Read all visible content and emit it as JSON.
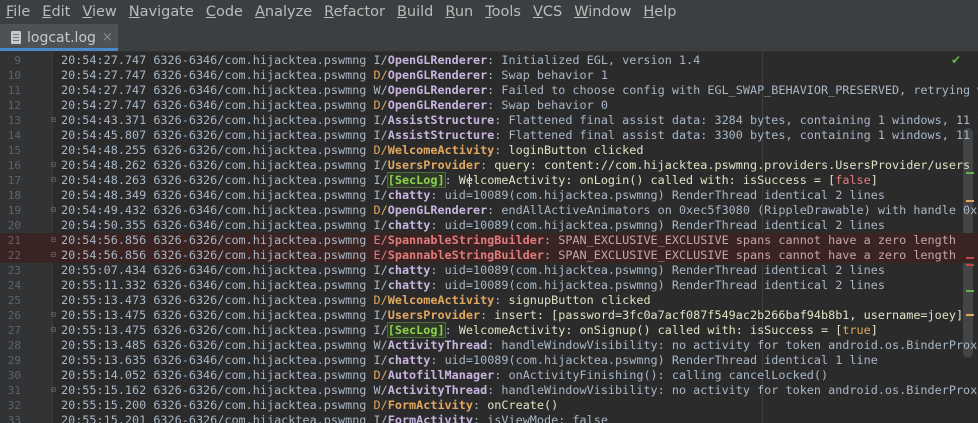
{
  "menu": [
    "File",
    "Edit",
    "View",
    "Navigate",
    "Code",
    "Analyze",
    "Refactor",
    "Build",
    "Run",
    "Tools",
    "VCS",
    "Window",
    "Help"
  ],
  "tab": {
    "label": "logcat.log",
    "close": "×"
  },
  "colors": {
    "accent": "#4a88c7",
    "error_row": "#3a2323",
    "seclog": "#8ed24e"
  },
  "lines": [
    {
      "n": "9",
      "ts": "20:54:27.747",
      "pid": "6326-6346",
      "pkg": "com.hijacktea.pswmng",
      "lvl": "I",
      "tag": "OpenGLRenderer",
      "msg": "Initialized EGL, version 1.4"
    },
    {
      "n": "10",
      "ts": "20:54:27.747",
      "pid": "6326-6346",
      "pkg": "com.hijacktea.pswmng",
      "lvl": "D",
      "tag": "OpenGLRenderer",
      "msg": "Swap behavior 1"
    },
    {
      "n": "11",
      "ts": "20:54:27.747",
      "pid": "6326-6346",
      "pkg": "com.hijacktea.pswmng",
      "lvl": "W",
      "tag": "OpenGLRenderer",
      "msg": "Failed to choose config with EGL_SWAP_BEHAVIOR_PRESERVED, retrying wi"
    },
    {
      "n": "12",
      "ts": "20:54:27.747",
      "pid": "6326-6346",
      "pkg": "com.hijacktea.pswmng",
      "lvl": "D",
      "tag": "OpenGLRenderer",
      "msg": "Swap behavior 0"
    },
    {
      "n": "13",
      "ts": "20:54:43.371",
      "pid": "6326-6326",
      "pkg": "com.hijacktea.pswmng",
      "lvl": "I",
      "tag": "AssistStructure",
      "msg": "Flattened final assist data: 3284 bytes, containing 1 windows, 11 vi"
    },
    {
      "n": "14",
      "ts": "20:54:45.807",
      "pid": "6326-6326",
      "pkg": "com.hijacktea.pswmng",
      "lvl": "I",
      "tag": "AssistStructure",
      "msg": "Flattened final assist data: 3300 bytes, containing 1 windows, 11 vi"
    },
    {
      "n": "15",
      "ts": "20:54:48.255",
      "pid": "6326-6326",
      "pkg": "com.hijacktea.pswmng",
      "lvl": "D",
      "tag": "WelcomeActivity",
      "msg": "loginButton clicked"
    },
    {
      "n": "16",
      "ts": "20:54:48.262",
      "pid": "6326-6326",
      "pkg": "com.hijacktea.pswmng",
      "lvl": "I",
      "tag": "UsersProvider",
      "msg": "query: content://com.hijacktea.pswmng.providers.UsersProvider/users"
    },
    {
      "n": "17",
      "ts": "20:54:48.263",
      "pid": "6326-6326",
      "pkg": "com.hijacktea.pswmng",
      "lvl": "I",
      "tag": "[SecLog]",
      "msg": "WelcomeActivity: onLogin() called with: isSuccess = [false]"
    },
    {
      "n": "18",
      "ts": "20:54:48.349",
      "pid": "6326-6346",
      "pkg": "com.hijacktea.pswmng",
      "lvl": "I",
      "tag": "chatty",
      "msg": "uid=10089(com.hijacktea.pswmng) RenderThread identical 2 lines"
    },
    {
      "n": "19",
      "ts": "20:54:49.432",
      "pid": "6326-6346",
      "pkg": "com.hijacktea.pswmng",
      "lvl": "D",
      "tag": "OpenGLRenderer",
      "msg": "endAllActiveAnimators on 0xec5f3080 (RippleDrawable) with handle 0xe"
    },
    {
      "n": "20",
      "ts": "20:54:50.355",
      "pid": "6326-6346",
      "pkg": "com.hijacktea.pswmng",
      "lvl": "I",
      "tag": "chatty",
      "msg": "uid=10089(com.hijacktea.pswmng) RenderThread identical 2 lines"
    },
    {
      "n": "21",
      "ts": "20:54:56.856",
      "pid": "6326-6326",
      "pkg": "com.hijacktea.pswmng",
      "lvl": "E",
      "tag": "SpannableStringBuilder",
      "msg": "SPAN_EXCLUSIVE_EXCLUSIVE spans cannot have a zero length"
    },
    {
      "n": "22",
      "ts": "20:54:56.856",
      "pid": "6326-6326",
      "pkg": "com.hijacktea.pswmng",
      "lvl": "E",
      "tag": "SpannableStringBuilder",
      "msg": "SPAN_EXCLUSIVE_EXCLUSIVE spans cannot have a zero length"
    },
    {
      "n": "23",
      "ts": "20:55:07.434",
      "pid": "6326-6346",
      "pkg": "com.hijacktea.pswmng",
      "lvl": "I",
      "tag": "chatty",
      "msg": "uid=10089(com.hijacktea.pswmng) RenderThread identical 2 lines"
    },
    {
      "n": "24",
      "ts": "20:55:11.332",
      "pid": "6326-6346",
      "pkg": "com.hijacktea.pswmng",
      "lvl": "I",
      "tag": "chatty",
      "msg": "uid=10089(com.hijacktea.pswmng) RenderThread identical 2 lines"
    },
    {
      "n": "25",
      "ts": "20:55:13.473",
      "pid": "6326-6326",
      "pkg": "com.hijacktea.pswmng",
      "lvl": "D",
      "tag": "WelcomeActivity",
      "msg": "signupButton clicked"
    },
    {
      "n": "26",
      "ts": "20:55:13.475",
      "pid": "6326-6326",
      "pkg": "com.hijacktea.pswmng",
      "lvl": "I",
      "tag": "UsersProvider",
      "msg": "insert: [password=3fc0a7acf087f549ac2b266baf94b8b1, username=joey]"
    },
    {
      "n": "27",
      "ts": "20:55:13.475",
      "pid": "6326-6326",
      "pkg": "com.hijacktea.pswmng",
      "lvl": "I",
      "tag": "[SecLog]",
      "msg": "WelcomeActivity: onSignup() called with: isSuccess = [true]"
    },
    {
      "n": "28",
      "ts": "20:55:13.485",
      "pid": "6326-6326",
      "pkg": "com.hijacktea.pswmng",
      "lvl": "W",
      "tag": "ActivityThread",
      "msg": "handleWindowVisibility: no activity for token android.os.BinderProxy@"
    },
    {
      "n": "29",
      "ts": "20:55:13.635",
      "pid": "6326-6346",
      "pkg": "com.hijacktea.pswmng",
      "lvl": "I",
      "tag": "chatty",
      "msg": "uid=10089(com.hijacktea.pswmng) RenderThread identical 1 line"
    },
    {
      "n": "30",
      "ts": "20:55:14.052",
      "pid": "6326-6346",
      "pkg": "com.hijacktea.pswmng",
      "lvl": "D",
      "tag": "AutofillManager",
      "msg": "onActivityFinishing(): calling cancelLocked()"
    },
    {
      "n": "31",
      "ts": "20:55:15.162",
      "pid": "6326-6326",
      "pkg": "com.hijacktea.pswmng",
      "lvl": "W",
      "tag": "ActivityThread",
      "msg": "handleWindowVisibility: no activity for token android.os.BinderProxy@"
    },
    {
      "n": "32",
      "ts": "20:55:15.200",
      "pid": "6326-6326",
      "pkg": "com.hijacktea.pswmng",
      "lvl": "D",
      "tag": "FormActivity",
      "msg": "onCreate()"
    },
    {
      "n": "33",
      "ts": "20:55:15.201",
      "pid": "6326-6326",
      "pkg": "com.hijacktea.pswmng",
      "lvl": "I",
      "tag": "FormActivity",
      "msg": "isViewMode: false"
    }
  ]
}
